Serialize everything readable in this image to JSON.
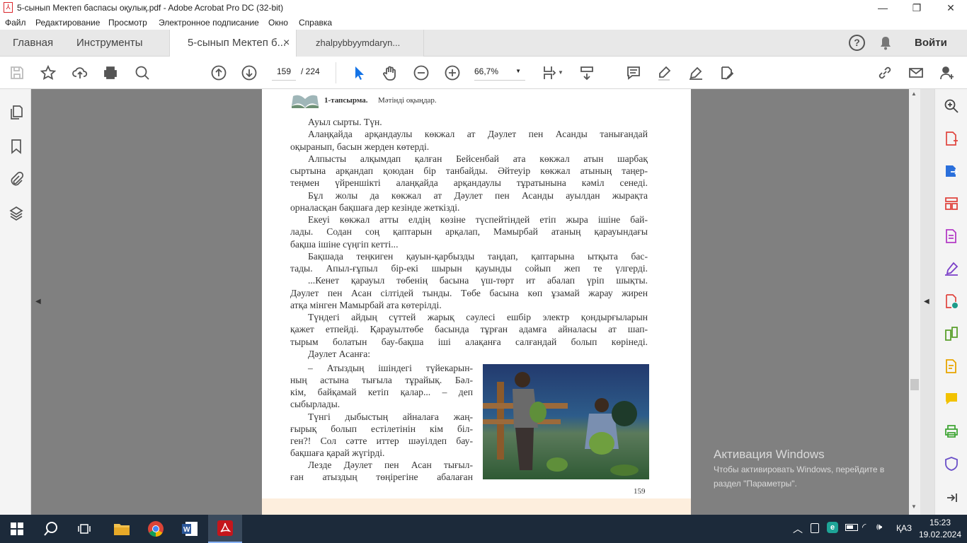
{
  "window": {
    "title": "5-сынып Мектеп баспасы оқулық.pdf - Adobe Acrobat Pro DC (32-bit)",
    "minimize": "—",
    "maximize": "❐",
    "close": "✕"
  },
  "menu": [
    "Файл",
    "Редактирование",
    "Просмотр",
    "Электронное подписание",
    "Окно",
    "Справка"
  ],
  "tabs": {
    "home": "Главная",
    "tools": "Инструменты",
    "active_doc": "5-сынып Мектеп б...",
    "close": "×",
    "other_doc": "zhalpybbyymdaryn...",
    "help": "?",
    "signin": "Войти"
  },
  "toolbar": {
    "page_current": "159",
    "page_total": "/ 224",
    "zoom": "66,7%"
  },
  "page": {
    "task_label": "1-тапсырма.",
    "task_text": "Мәтінді оқыңдар.",
    "page_number": "159",
    "lines": [
      {
        "t": "Ауыл  сырты.  Түн.",
        "i": 1,
        "l": 1
      },
      {
        "t": "Алаңқайда  арқандаулы  көкжал  ат Дәулет пен Асанды танығандай",
        "i": 1
      },
      {
        "t": "оқыранып,  басын  жерден  көтерді.",
        "l": 1
      },
      {
        "t": "Алпысты алқымдап қалған Бейсенбай ата көкжал атын шарбақ",
        "i": 1
      },
      {
        "t": "сыртына арқандап қоюдан бір танбайды. Әйтеуір көкжал атының таңер-"
      },
      {
        "t": "теңмен үйреншікті алаңқайда арқандаулы тұратынына кәміл сенеді."
      },
      {
        "t": "Бұл жолы да көкжал ат Дәулет пен Асанды ауылдан жырақта",
        "i": 1
      },
      {
        "t": "орналасқан  бақшаға  дер кезінде  жеткізді.",
        "l": 1
      },
      {
        "t": "Екеуі көкжал атты елдің көзіне түспейтіндей етіп жыра ішіне бай-",
        "i": 1
      },
      {
        "t": "лады. Содан соң қаптарын арқалап, Мамырбай атаның қарауындағы"
      },
      {
        "t": "бақша  ішіне  сүңгіп  кетті...",
        "l": 1
      },
      {
        "t": "Бақшада теңкиген қауын-қарбызды таңдап, қаптарына ытқыта бас-",
        "i": 1
      },
      {
        "t": "тады. Апыл-ғұпыл бір-екі шырын қауынды сойып жеп те үлгерді."
      },
      {
        "t": "...Кенет қарауыл төбенің басына үш-төрт ит абалап үріп шықты.",
        "i": 1
      },
      {
        "t": "Дәулет пен Асан сілтідей тынды. Төбе басына көп ұзамай жарау жирен"
      },
      {
        "t": "атқа  мінген  Мамырбай  ата  көтерілді.",
        "l": 1
      },
      {
        "t": "Түндегі айдың сүттей жарық сәулесі ешбір электр қондырғыларын",
        "i": 1
      },
      {
        "t": "қажет етпейді. Қарауылтөбе басында тұрған адамға айналасы ат шап-"
      },
      {
        "t": "тырым болатын бау-бақша іші алақанға салғандай болып көрінеді."
      },
      {
        "t": "Дәулет  Асанға:",
        "i": 1,
        "l": 1
      },
      {
        "t": "– Атыздың ішіндегі түйекарын-",
        "i": 1,
        "n": 1
      },
      {
        "t": "ның астына тығыла тұрайық. Бәл-",
        "n": 1
      },
      {
        "t": "кім, байқамай кетіп қалар... – деп",
        "n": 1
      },
      {
        "t": "сыбырлады.",
        "n": 1,
        "l": 1
      },
      {
        "t": "Түнгі дыбыстың айналаға жаң-",
        "i": 1,
        "n": 1
      },
      {
        "t": "ғырық болып естілетінін кім біл-",
        "n": 1
      },
      {
        "t": "ген?! Сол сәтте иттер шәуілдеп бау-",
        "n": 1
      },
      {
        "t": "бақшаға  қарай  жүгірді.",
        "n": 1,
        "l": 1
      },
      {
        "t": "Лезде Дәулет пен Асан тығыл-",
        "i": 1,
        "n": 1
      },
      {
        "t": "ған атыздың төңірегіне абалаған",
        "n": 1
      }
    ]
  },
  "watermark": {
    "title": "Активация Windows",
    "line1": "Чтобы активировать Windows, перейдите в",
    "line2": "раздел \"Параметры\"."
  },
  "taskbar": {
    "lang": "ҚАЗ",
    "time": "15:23",
    "date": "19.02.2024"
  },
  "colors": {
    "accent": "#1473e6",
    "acrobat_red": "#d9262c",
    "taskbar": "#1c2a3a"
  }
}
